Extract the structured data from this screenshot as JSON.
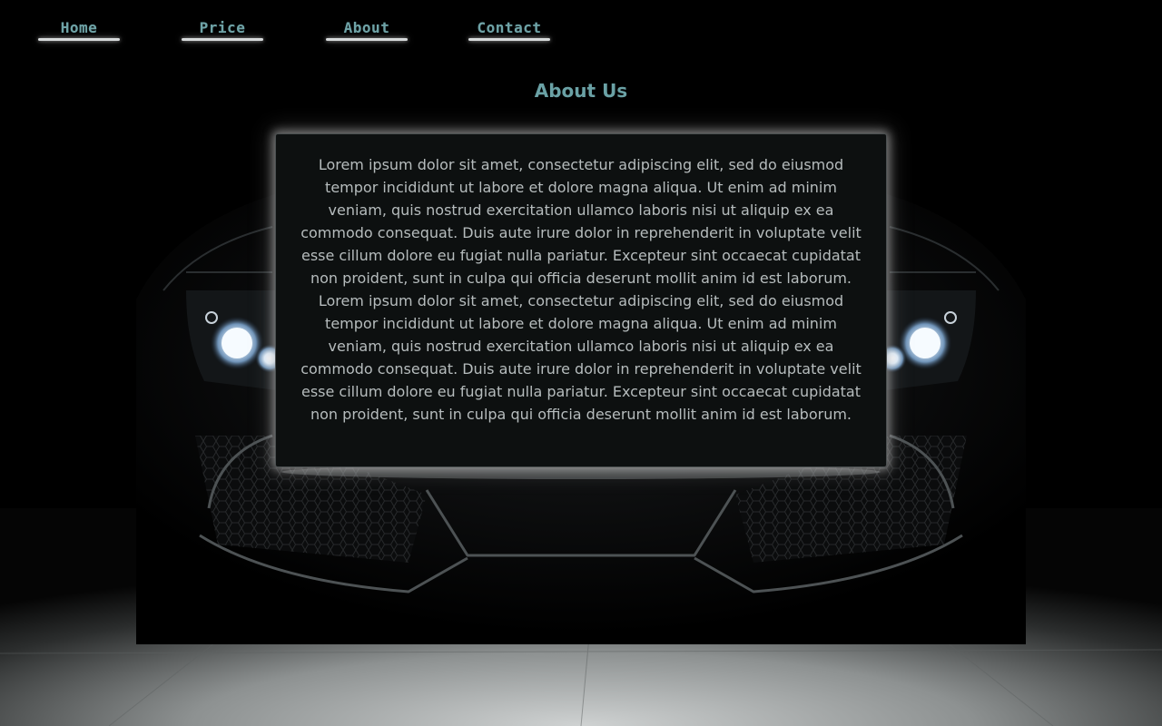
{
  "nav": {
    "home": "Home",
    "price": "Price",
    "about": "About",
    "contact": "Contact"
  },
  "page": {
    "title": "About Us"
  },
  "about": {
    "body": "Lorem ipsum dolor sit amet, consectetur adipiscing elit, sed do eiusmod tempor incididunt ut labore et dolore magna aliqua. Ut enim ad minim veniam, quis nostrud exercitation ullamco laboris nisi ut aliquip ex ea commodo consequat. Duis aute irure dolor in reprehenderit in voluptate velit esse cillum dolore eu fugiat nulla pariatur. Excepteur sint occaecat cupidatat non proident, sunt in culpa qui officia deserunt mollit anim id est laborum. Lorem ipsum dolor sit amet, consectetur adipiscing elit, sed do eiusmod tempor incididunt ut labore et dolore magna aliqua. Ut enim ad minim veniam, quis nostrud exercitation ullamco laboris nisi ut aliquip ex ea commodo consequat. Duis aute irure dolor in reprehenderit in voluptate velit esse cillum dolore eu fugiat nulla pariatur. Excepteur sint occaecat cupidatat non proident, sunt in culpa qui officia deserunt mollit anim id est laborum."
  },
  "theme": {
    "accent": "#6aa1a5",
    "background": "#000000",
    "box_background": "#0d1010",
    "text": "#b6bcbd"
  },
  "background_image": {
    "subject": "car-front-in-dark-garage"
  }
}
